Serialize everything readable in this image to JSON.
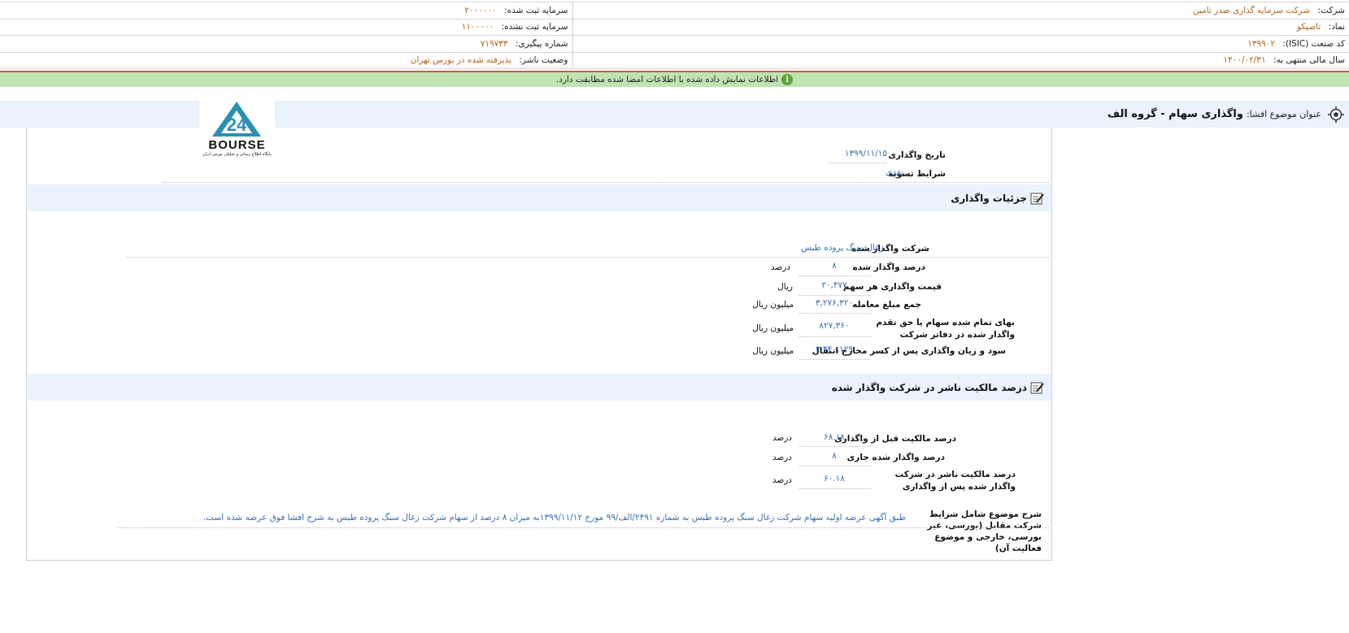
{
  "header": {
    "company_label": "شرکت:",
    "company_value": "شرکت سرمایه گذاری صدر تامین",
    "registered_capital_label": "سرمایه ثبت شده:",
    "registered_capital_value": "۲۰۰۰۰۰۰",
    "symbol_label": "نماد:",
    "symbol_value": "تاصیکو",
    "unregistered_capital_label": "سرمایه ثبت نشده:",
    "unregistered_capital_value": "۱۱۰۰۰۰۰",
    "isic_label": "کد صنعت (ISIC):",
    "isic_value": "۱۳۹۹۰۲",
    "tracking_label": "شماره پیگیری:",
    "tracking_value": "۷۱۹۷۳۳",
    "fiscal_year_label": "سال مالی منتهی به:",
    "fiscal_year_value": "۱۴۰۰/۰۲/۳۱",
    "publisher_status_label": "وضعیت ناشر:",
    "publisher_status_value": "پذیرفته شده در بورس تهران"
  },
  "status": {
    "message": "اطلاعات نمایش داده شده با اطلاعات امضا شده مطابقت دارد.",
    "icon": "info-icon",
    "color": "#bfe3b1"
  },
  "title": {
    "label": "عنوان موضوع افشا:",
    "value": "واگذاری سهام - گروه الف"
  },
  "logo": {
    "text": "BOURSE",
    "subtitle": "پایگاه اطلاع رسانی و تحلیلی بورس ایران"
  },
  "general": {
    "date_label": "تاریخ واگذاری",
    "date_value": "۱۳۹۹/۱۱/۱۵",
    "settlement_label": "شرایط تسویه",
    "settlement_value": "نقدی"
  },
  "section1": {
    "title": "جزئیات واگذاری",
    "company_label": "شرکت واگذار شده",
    "company_value": "زغال سنگ پروده طبس",
    "rows": [
      {
        "label": "درصد واگذار شده",
        "value": "۸",
        "unit": "درصد"
      },
      {
        "label": "قیمت واگذاری هر سهم",
        "value": "۲۰,۴۷۷",
        "unit": "ریال"
      },
      {
        "label": "جمع مبلغ معامله",
        "value": "۳,۲۷۶,۳۲۰",
        "unit": "میلیون ریال"
      },
      {
        "label": "بهای تمام شده سهام یا حق تقدم واگذار شده در دفاتر شرکت",
        "value": "۸۲۷,۳۶۰",
        "unit": "میلیون ریال"
      },
      {
        "label": "سود و زیان واگذاری پس از کسر مخارج انتقال",
        "value": "۲,۴۴۰,۱۲۹",
        "unit": "میلیون ریال"
      }
    ]
  },
  "section2": {
    "title": "درصد مالکیت ناشر در شرکت واگذار شده",
    "rows": [
      {
        "label": "درصد مالکیت قبل از واگذاری",
        "value": "۶۸.۱۸",
        "unit": "درصد"
      },
      {
        "label": "درصد واگذار شده جاری",
        "value": "۸",
        "unit": "درصد"
      },
      {
        "label": "درصد مالکیت ناشر در شرکت واگذار شده پس از واگذاری",
        "value": "۶۰.۱۸",
        "unit": "درصد"
      }
    ],
    "desc_label": "شرح موضوع شامل شرایط شرکت مقابل (بورسی، غیر بورسی، خارجی و موضوع فعالیت آن)",
    "desc_value_line1": "طبق آگهی عرضه اولیه سهام شرکت زغال سنگ پروده طبس به شماره ۲۴۹۱/الف/۹۹ مورخ ۱۳۹۹/۱۱/۱۲به میزان ۸ درصد از سهام شرکت زغال سنگ پروده طبس به شرح افشا فوق عرضه شده است."
  }
}
